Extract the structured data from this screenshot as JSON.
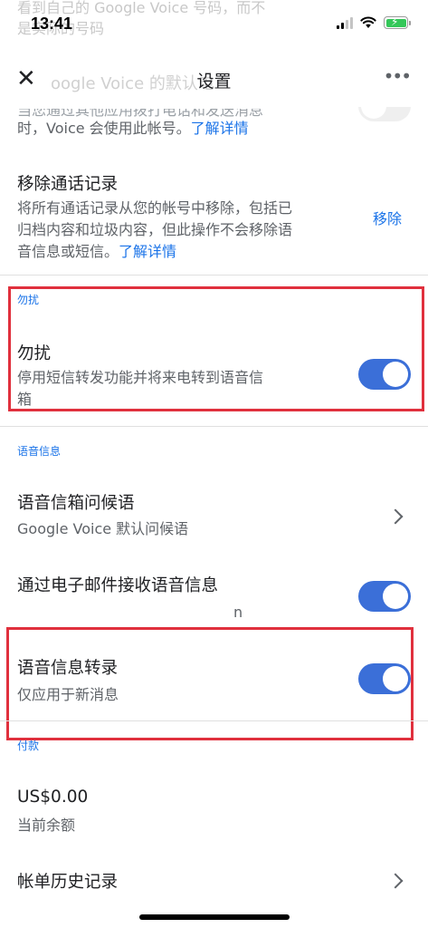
{
  "status_bar": {
    "time": "13:41",
    "overlay_line1": "看到自己的 Google Voice 号码，而不",
    "overlay_line2": "是实际的号码"
  },
  "app_bar": {
    "close_glyph": "✕",
    "title": "设置",
    "overlay_text": "oogle Voice 的默认电",
    "more_glyph": "•••"
  },
  "use_account_row": {
    "subtitle_partial": "当您通过其他应用拨打电话和发送消息",
    "subtitle_line2": "时，Voice 会使用此帐号。",
    "link": "了解详情"
  },
  "remove_history": {
    "title": "移除通话记录",
    "subtitle_line1": "将所有通话记录从您的帐号中移除，包括已",
    "subtitle_line2": "归档内容和垃圾内容，但此操作不会移除语",
    "subtitle_line3": "音信息或短信。",
    "link": "了解详情",
    "action": "移除"
  },
  "dnd": {
    "section": "勿扰",
    "title": "勿扰",
    "subtitle_line1": "停用短信转发功能并将来电转到语音信",
    "subtitle_line2": "箱",
    "toggle_on": true
  },
  "voicemail": {
    "section": "语音信息",
    "greeting_title": "语音信箱问候语",
    "greeting_subtitle": "Google Voice 默认问候语",
    "email_title": "通过电子邮件接收语音信息",
    "email_subtitle_partial": "n",
    "email_toggle_on": true,
    "transcribe_title": "语音信息转录",
    "transcribe_subtitle": "仅应用于新消息",
    "transcribe_toggle_on": true
  },
  "payments": {
    "section": "付款",
    "balance_value": "US$0.00",
    "balance_label": "当前余额",
    "billing_history": "帐单历史记录"
  },
  "colors": {
    "accent": "#1a73e8",
    "toggle_on": "#3b6fd8",
    "highlight": "#e0303d"
  },
  "icons": [
    "close-icon",
    "more-icon",
    "chevron-right-icon",
    "signal-icon",
    "wifi-icon",
    "battery-icon"
  ]
}
